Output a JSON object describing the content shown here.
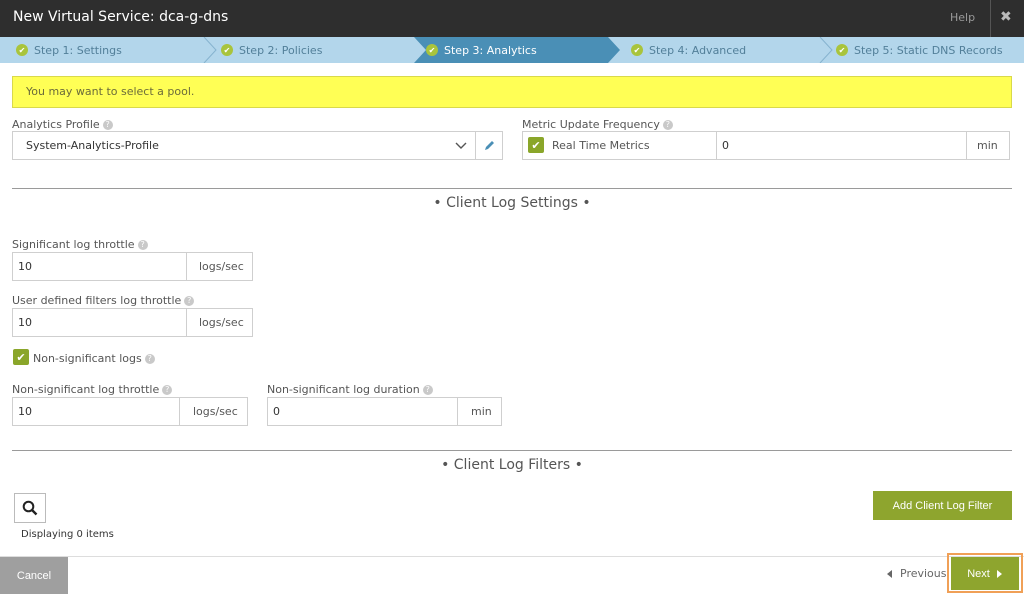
{
  "header": {
    "title": "New Virtual Service: dca-g-dns",
    "help_label": "Help",
    "close_glyph": "✖"
  },
  "steps": [
    {
      "label": "Step 1: Settings",
      "state": "done"
    },
    {
      "label": "Step 2: Policies",
      "state": "done"
    },
    {
      "label": "Step 3: Analytics",
      "state": "active"
    },
    {
      "label": "Step 4: Advanced",
      "state": "done"
    },
    {
      "label": "Step 5: Static DNS Records",
      "state": "done"
    }
  ],
  "warning": {
    "text": "You may want to select a pool."
  },
  "analytics_profile": {
    "label": "Analytics Profile",
    "value": "System-Analytics-Profile"
  },
  "metric_update": {
    "label": "Metric Update Frequency",
    "checkbox_label": "Real Time Metrics",
    "checked": true,
    "value": "0",
    "unit": "min"
  },
  "client_log_settings": {
    "title": "• Client Log Settings •",
    "significant_throttle": {
      "label": "Significant log throttle",
      "value": "10",
      "unit": "logs/sec"
    },
    "user_defined_throttle": {
      "label": "User defined filters log throttle",
      "value": "10",
      "unit": "logs/sec"
    },
    "non_significant_logs": {
      "label": "Non-significant logs",
      "checked": true
    },
    "non_significant_throttle": {
      "label": "Non-significant log throttle",
      "value": "10",
      "unit": "logs/sec"
    },
    "non_significant_duration": {
      "label": "Non-significant log duration",
      "value": "0",
      "unit": "min"
    }
  },
  "client_log_filters": {
    "title": "• Client Log Filters •",
    "add_button_label": "Add Client Log Filter",
    "displaying_text": "Displaying 0 items"
  },
  "footer": {
    "cancel_label": "Cancel",
    "previous_label": "Previous",
    "next_label": "Next"
  },
  "colors": {
    "header_bg": "#2e2e2e",
    "steps_bg": "#b3d6eb",
    "active_step_bg": "#4a8fb6",
    "warning_bg": "#ffff55",
    "accent_green": "#8ea52e",
    "cancel_bg": "#9f9f9f",
    "focus_outline": "#f0a057"
  },
  "icons": {
    "step_done": "check-circle-icon",
    "help": "question-circle-icon",
    "edit": "pencil-icon",
    "dropdown": "chevron-down-icon",
    "search": "search-icon",
    "previous": "caret-left-icon",
    "next": "caret-right-icon"
  }
}
